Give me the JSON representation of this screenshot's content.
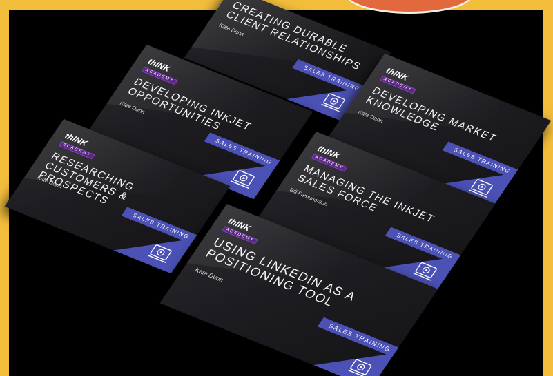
{
  "brand": {
    "logo_word": "thINK",
    "logo_sub": "ACADEMY"
  },
  "colors": {
    "frame": "#f3bd3c",
    "accent": "#4b51b5",
    "card": "#1d1d21"
  },
  "cards": [
    {
      "title": "Creating Durable Client Relationships",
      "author": "Kate Dunn",
      "tag": "SALES TRAINING"
    },
    {
      "title": "Developing Inkjet Opportunities",
      "author": "Kate Dunn",
      "tag": "SALES TRAINING"
    },
    {
      "title": "Developing Market Knowledge",
      "author": "Kate Dunn",
      "tag": "SALES TRAINING"
    },
    {
      "title": "Researching Customers & Prospects",
      "author": "Kate Dunn",
      "tag": "SALES TRAINING"
    },
    {
      "title": "Managing the Inkjet Sales Force",
      "author": "Bill Farquharson",
      "tag": "SALES TRAINING"
    },
    {
      "title": "Using LinkedIn as a Positioning Tool",
      "author": "Kate Dunn",
      "tag": "SALES TRAINING"
    }
  ]
}
